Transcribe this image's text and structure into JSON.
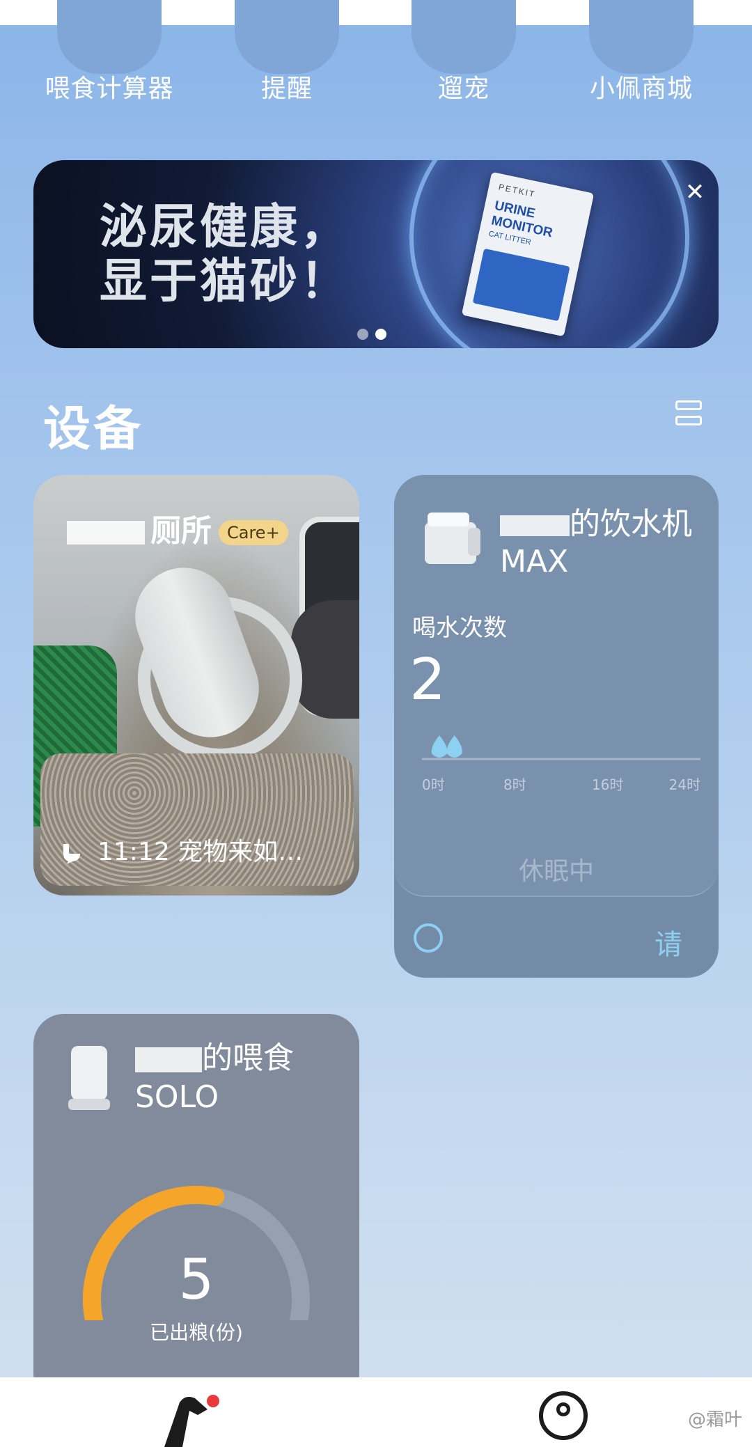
{
  "shortcuts": [
    {
      "label": "喂食计算器"
    },
    {
      "label": "提醒"
    },
    {
      "label": "遛宠"
    },
    {
      "label": "小佩商城"
    }
  ],
  "banner": {
    "headline_line1": "泌尿健康，",
    "headline_line2": "显于猫砂！",
    "product_brand": "PETKIT",
    "product_name": "URINE MONITOR",
    "product_sub": "CAT LITTER",
    "close_glyph": "✕",
    "page_count": 2,
    "active_page": 2
  },
  "devices_section": {
    "title": "设备"
  },
  "litter_box": {
    "title_suffix": "厕所",
    "badge": "Care+",
    "event_text": "11:12 宠物来如…"
  },
  "fountain": {
    "name": "的饮水机MAX",
    "metric_label": "喝水次数",
    "count": "2",
    "chart_data": {
      "type": "scatter",
      "x_ticks": [
        "0时",
        "8时",
        "16时",
        "24时"
      ],
      "xlim": [
        0,
        24
      ],
      "events_hours": [
        1.5,
        2.8
      ]
    },
    "status": "休眠中",
    "action_label": "请",
    "accent_color": "#8ed0f2"
  },
  "feeder": {
    "name_prefix": "的喂食",
    "name_suffix": "SOLO",
    "dispensed_count": "5",
    "dispensed_label": "已出粮(份)",
    "gauge_fraction": 0.55,
    "gauge_color": "#f4a52a"
  },
  "watermark": "@霜叶"
}
